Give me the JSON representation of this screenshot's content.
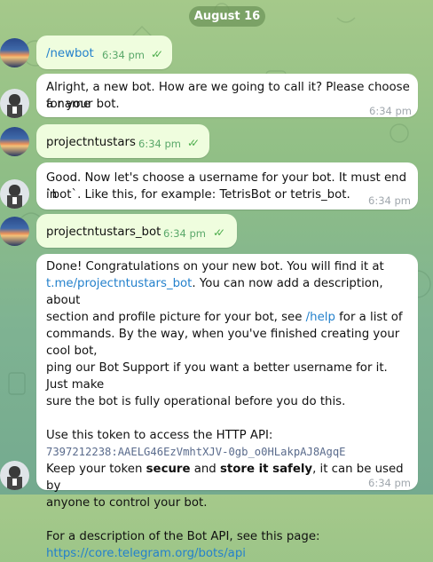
{
  "date_label": "August 16",
  "colors": {
    "outgoing_bubble": "#effdde",
    "incoming_bubble": "#ffffff",
    "link": "#2481cc",
    "check": "#4fae4e"
  },
  "messages": [
    {
      "dir": "out",
      "text": "/newbot",
      "time": "6:34 pm"
    },
    {
      "dir": "in",
      "lines": [
        "Alright, a new bot. How are we going to call it? Please choose a name",
        "for your bot."
      ],
      "time": "6:34 pm"
    },
    {
      "dir": "out",
      "text": "projectntustars",
      "time": "6:34 pm"
    },
    {
      "dir": "in",
      "lines": [
        "Good. Now let's choose a username for your bot. It must end in",
        "`bot`. Like this, for example: TetrisBot or tetris_bot."
      ],
      "time": "6:34 pm"
    },
    {
      "dir": "out",
      "text": "projectntustars_bot",
      "time": "6:34 pm"
    },
    {
      "dir": "in",
      "time": "6:34 pm",
      "intro": "Done! Congratulations on your new bot. You will find it at",
      "bot_link": "t.me/projectntustars_bot",
      "after_link": ". You can now add a description, about",
      "line3": "section and profile picture for your bot, see",
      "help_link": "/help",
      "after_help": "for a list of",
      "line4": "commands. By the way, when you've finished creating your cool bot,",
      "line5": "ping our Bot Support if you want a better username for it. Just make",
      "line6": "sure the bot is fully operational before you do this.",
      "token_intro": "Use this token to access the HTTP API:",
      "token": "7397212238:AAELG46EzVmhtXJV-0gb_o0HLakpAJ8AgqE",
      "keep_prefix": "Keep your token",
      "secure": "secure",
      "and": "and",
      "store": "store it safely",
      "keep_suffix": ", it can be used by",
      "keep_line2": "anyone to control your bot.",
      "api_intro": "For a description of the Bot API, see this page:",
      "api_link": "https://core.telegram.org/bots/api"
    }
  ]
}
